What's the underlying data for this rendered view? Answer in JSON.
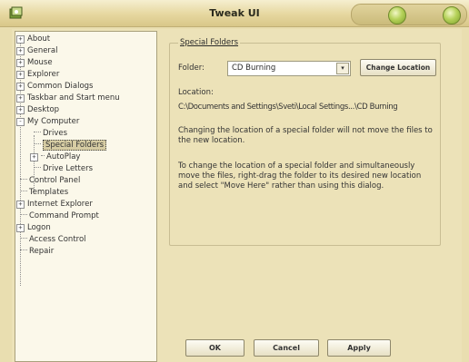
{
  "window": {
    "title": "Tweak UI"
  },
  "tree": {
    "items": [
      {
        "label": "About",
        "expander": "+"
      },
      {
        "label": "General",
        "expander": "+"
      },
      {
        "label": "Mouse",
        "expander": "+"
      },
      {
        "label": "Explorer",
        "expander": "+"
      },
      {
        "label": "Common Dialogs",
        "expander": "+"
      },
      {
        "label": "Taskbar and Start menu",
        "expander": "+"
      },
      {
        "label": "Desktop",
        "expander": "+"
      },
      {
        "label": "My Computer",
        "expander": "-"
      },
      {
        "label": "Drives"
      },
      {
        "label": "Special Folders"
      },
      {
        "label": "AutoPlay",
        "expander": "+"
      },
      {
        "label": "Drive Letters"
      },
      {
        "label": "Control Panel"
      },
      {
        "label": "Templates"
      },
      {
        "label": "Internet Explorer",
        "expander": "+"
      },
      {
        "label": "Command Prompt"
      },
      {
        "label": "Logon",
        "expander": "+"
      },
      {
        "label": "Access Control"
      },
      {
        "label": "Repair"
      }
    ]
  },
  "panel": {
    "group_title": "Special Folders",
    "folder_label": "Folder:",
    "folder_value": "CD Burning",
    "change_location_label": "Change Location",
    "location_label": "Location:",
    "location_path": "C:\\Documents and Settings\\Sveti\\Local Settings...\\CD Burning",
    "note_1": "Changing the location of a special folder will not move the files to the new location.",
    "note_2": "To change the location of a special folder and simultaneously move the files, right-drag the folder to its desired new location and select \"Move Here\" rather than using this dialog."
  },
  "buttons": {
    "ok": "OK",
    "cancel": "Cancel",
    "apply": "Apply"
  },
  "colors": {
    "background": "#e9deb0",
    "selection": "#d6cca3",
    "orb": "#b6d25a"
  }
}
